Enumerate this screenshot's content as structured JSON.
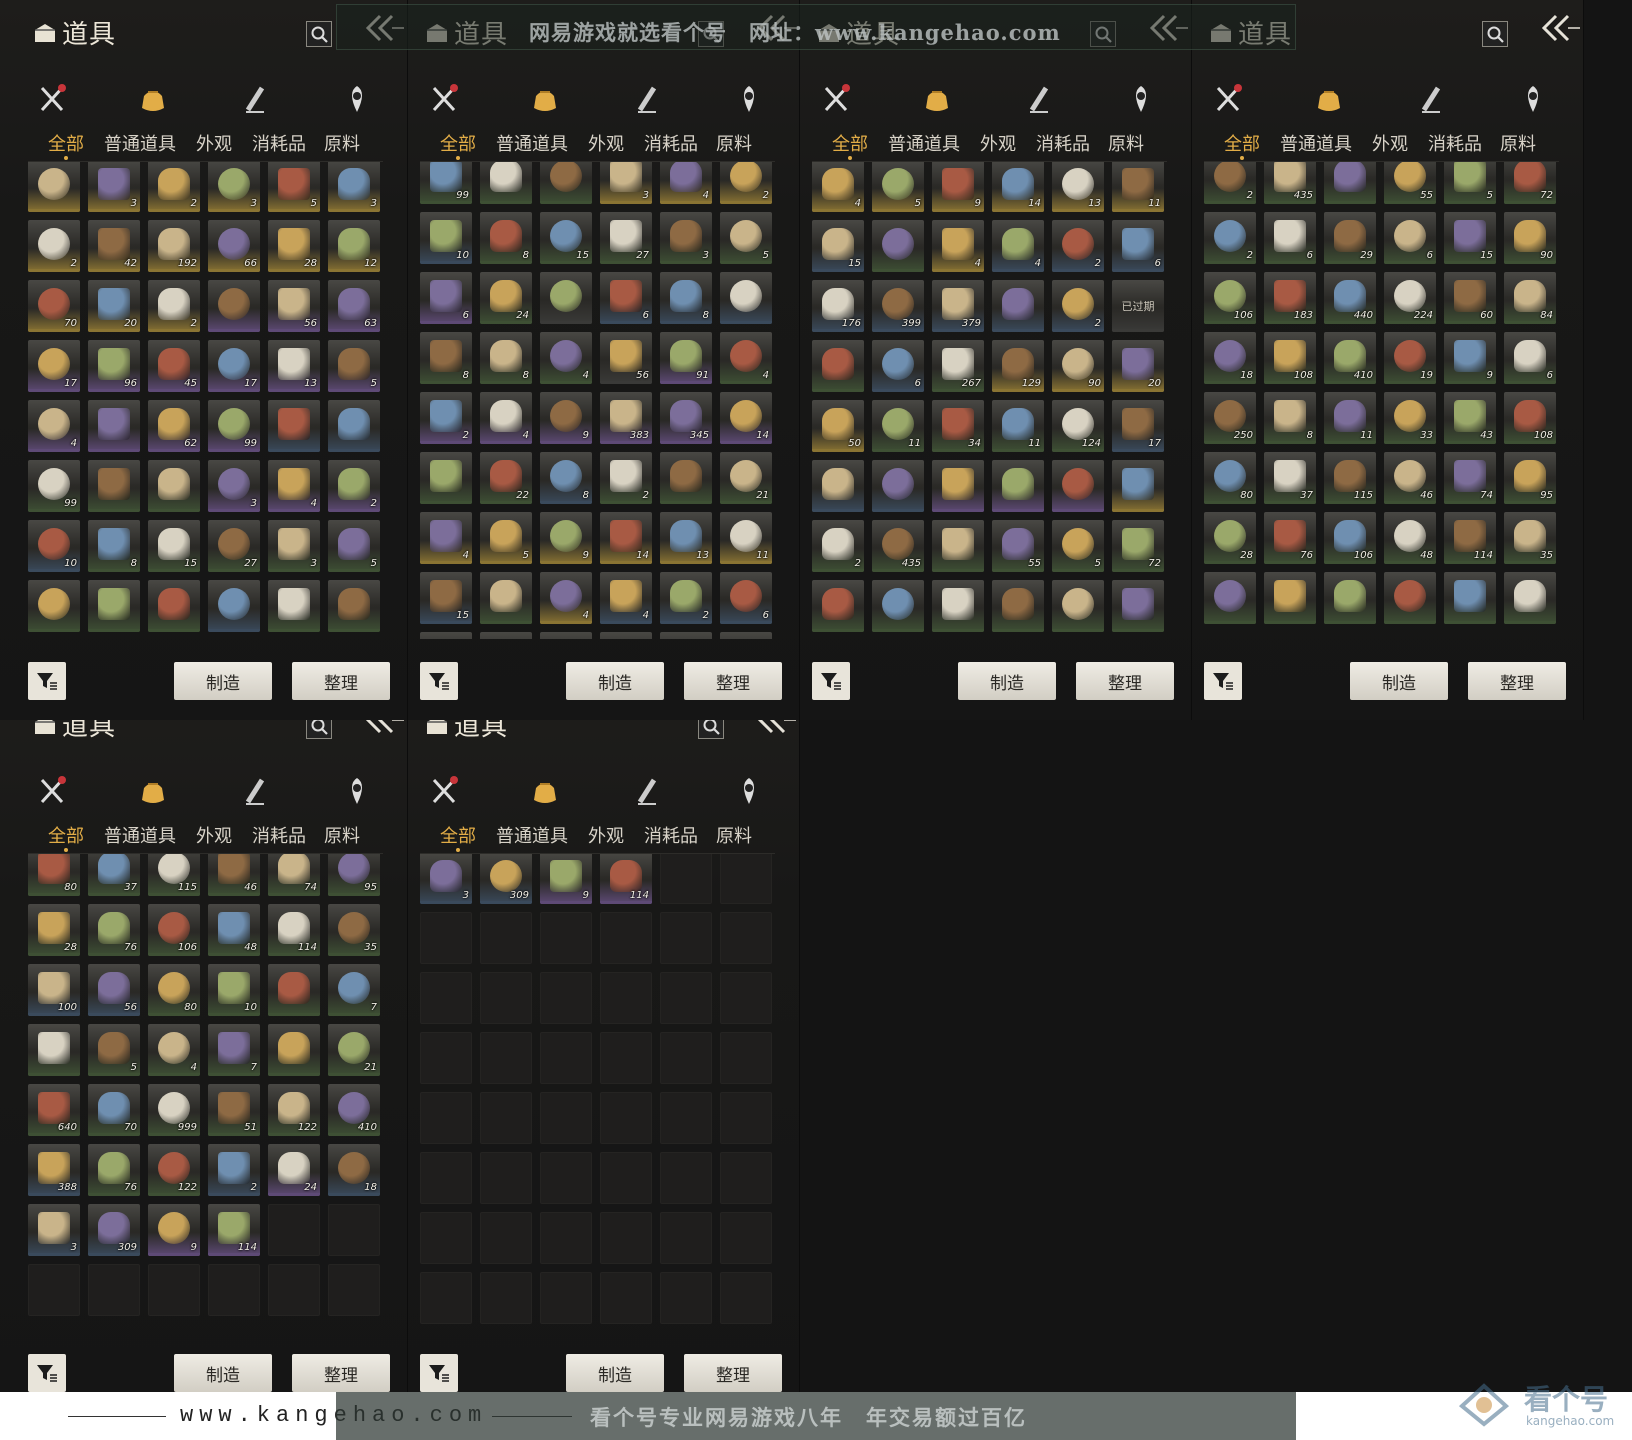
{
  "panel": {
    "title": "道具",
    "tabs": [
      "全部",
      "普通道具",
      "外观",
      "消耗品",
      "原料"
    ],
    "active_tab": "全部",
    "category_icons": [
      "weapons-icon",
      "items-pouch-icon",
      "scroll-icon",
      "quest-icon"
    ],
    "active_category": "items-pouch-icon",
    "make_label": "制造",
    "sort_label": "整理"
  },
  "colors": {
    "gold_tab": "#e2ad47",
    "rarity_gold": "#8a7433",
    "rarity_purple": "#5e4a76",
    "rarity_green": "#3e5034",
    "rarity_blue": "#3a4a5c",
    "rarity_gray": "#3a3a38"
  },
  "panels": [
    {
      "id": "panel-1",
      "slots": [
        [
          "gold",
          ""
        ],
        [
          "gold",
          "3"
        ],
        [
          "gold",
          "2"
        ],
        [
          "gold",
          "3"
        ],
        [
          "gold",
          "5"
        ],
        [
          "gold",
          "3"
        ],
        [
          "gold",
          "2"
        ],
        [
          "gold",
          "42"
        ],
        [
          "gold",
          "192"
        ],
        [
          "gold",
          "66"
        ],
        [
          "gold",
          "28"
        ],
        [
          "gold",
          "12"
        ],
        [
          "gold",
          "70"
        ],
        [
          "gold",
          "20"
        ],
        [
          "gold",
          "2"
        ],
        [
          "purple",
          ""
        ],
        [
          "purple",
          "56"
        ],
        [
          "purple",
          "63"
        ],
        [
          "purple",
          "17"
        ],
        [
          "purple",
          "96"
        ],
        [
          "purple",
          "45"
        ],
        [
          "purple",
          "17"
        ],
        [
          "purple",
          "13"
        ],
        [
          "purple",
          "5"
        ],
        [
          "purple",
          "4"
        ],
        [
          "purple",
          ""
        ],
        [
          "purple",
          "62"
        ],
        [
          "purple",
          "99"
        ],
        [
          "blue",
          ""
        ],
        [
          "blue",
          ""
        ],
        [
          "green",
          "99"
        ],
        [
          "green",
          ""
        ],
        [
          "green",
          ""
        ],
        [
          "purple",
          "3"
        ],
        [
          "purple",
          "4"
        ],
        [
          "purple",
          "2"
        ],
        [
          "blue",
          "10"
        ],
        [
          "green",
          "8"
        ],
        [
          "green",
          "15"
        ],
        [
          "green",
          "27"
        ],
        [
          "green",
          "3"
        ],
        [
          "green",
          "5"
        ],
        [
          "green",
          ""
        ],
        [
          "green",
          ""
        ],
        [
          "green",
          ""
        ],
        [
          "blue",
          ""
        ],
        [
          "green",
          ""
        ],
        [
          "green",
          ""
        ]
      ]
    },
    {
      "id": "panel-2",
      "slots": [
        [
          "green",
          "99"
        ],
        [
          "green",
          ""
        ],
        [
          "green",
          ""
        ],
        [
          "gold",
          "3"
        ],
        [
          "gold",
          "4"
        ],
        [
          "gold",
          "2"
        ],
        [
          "blue",
          "10"
        ],
        [
          "green",
          "8"
        ],
        [
          "green",
          "15"
        ],
        [
          "green",
          "27"
        ],
        [
          "green",
          "3"
        ],
        [
          "green",
          "5"
        ],
        [
          "purple",
          "6"
        ],
        [
          "green",
          "24"
        ],
        [
          "gray",
          ""
        ],
        [
          "blue",
          "6"
        ],
        [
          "blue",
          "8"
        ],
        [
          "blue",
          ""
        ],
        [
          "green",
          "8"
        ],
        [
          "green",
          "8"
        ],
        [
          "green",
          "4"
        ],
        [
          "gray",
          "56"
        ],
        [
          "purple",
          "91"
        ],
        [
          "green",
          "4"
        ],
        [
          "purple",
          "2"
        ],
        [
          "purple",
          "4"
        ],
        [
          "purple",
          "9"
        ],
        [
          "purple",
          "383"
        ],
        [
          "purple",
          "345"
        ],
        [
          "purple",
          "14"
        ],
        [
          "green",
          ""
        ],
        [
          "green",
          "22"
        ],
        [
          "blue",
          "8"
        ],
        [
          "green",
          "2"
        ],
        [
          "green",
          ""
        ],
        [
          "green",
          "21"
        ],
        [
          "gold",
          "4"
        ],
        [
          "gold",
          "5"
        ],
        [
          "gold",
          "9"
        ],
        [
          "gold",
          "14"
        ],
        [
          "gold",
          "13"
        ],
        [
          "gold",
          "11"
        ],
        [
          "blue",
          "15"
        ],
        [
          "green",
          ""
        ],
        [
          "gold",
          "4"
        ],
        [
          "blue",
          "4"
        ],
        [
          "blue",
          "2"
        ],
        [
          "blue",
          "6"
        ],
        [
          "green",
          ""
        ],
        [
          "green",
          ""
        ],
        [
          "green",
          ""
        ],
        [
          "green",
          ""
        ],
        [
          "green",
          ""
        ],
        [
          "green",
          ""
        ]
      ]
    },
    {
      "id": "panel-3",
      "slots": [
        [
          "gold",
          "4"
        ],
        [
          "gold",
          "5"
        ],
        [
          "gold",
          "9"
        ],
        [
          "gold",
          "14"
        ],
        [
          "gold",
          "13"
        ],
        [
          "gold",
          "11"
        ],
        [
          "blue",
          "15"
        ],
        [
          "green",
          ""
        ],
        [
          "gold",
          "4"
        ],
        [
          "blue",
          "4"
        ],
        [
          "blue",
          "2"
        ],
        [
          "blue",
          "6"
        ],
        [
          "blue",
          "176"
        ],
        [
          "blue",
          "399"
        ],
        [
          "blue",
          "379"
        ],
        [
          "blue",
          ""
        ],
        [
          "blue",
          "2"
        ],
        [
          "gray",
          "已过期"
        ],
        [
          "green",
          ""
        ],
        [
          "blue",
          "6"
        ],
        [
          "green",
          "267"
        ],
        [
          "gold",
          "129"
        ],
        [
          "gold",
          "90"
        ],
        [
          "gold",
          "20"
        ],
        [
          "gold",
          "50"
        ],
        [
          "green",
          "11"
        ],
        [
          "green",
          "34"
        ],
        [
          "green",
          "11"
        ],
        [
          "green",
          "124"
        ],
        [
          "blue",
          "17"
        ],
        [
          "blue",
          ""
        ],
        [
          "blue",
          ""
        ],
        [
          "purple",
          ""
        ],
        [
          "purple",
          ""
        ],
        [
          "purple",
          ""
        ],
        [
          "gold",
          ""
        ],
        [
          "green",
          "2"
        ],
        [
          "green",
          "435"
        ],
        [
          "green",
          ""
        ],
        [
          "green",
          "55"
        ],
        [
          "green",
          "5"
        ],
        [
          "green",
          "72"
        ],
        [
          "green",
          ""
        ],
        [
          "green",
          ""
        ],
        [
          "green",
          ""
        ],
        [
          "green",
          ""
        ],
        [
          "green",
          ""
        ],
        [
          "green",
          ""
        ]
      ]
    },
    {
      "id": "panel-4",
      "slots": [
        [
          "green",
          "2"
        ],
        [
          "green",
          "435"
        ],
        [
          "green",
          ""
        ],
        [
          "green",
          "55"
        ],
        [
          "green",
          "5"
        ],
        [
          "green",
          "72"
        ],
        [
          "green",
          "2"
        ],
        [
          "green",
          "6"
        ],
        [
          "green",
          "29"
        ],
        [
          "green",
          "6"
        ],
        [
          "green",
          "15"
        ],
        [
          "green",
          "90"
        ],
        [
          "green",
          "106"
        ],
        [
          "green",
          "183"
        ],
        [
          "green",
          "440"
        ],
        [
          "green",
          "224"
        ],
        [
          "green",
          "60"
        ],
        [
          "green",
          "84"
        ],
        [
          "green",
          "18"
        ],
        [
          "green",
          "108"
        ],
        [
          "green",
          "410"
        ],
        [
          "green",
          "19"
        ],
        [
          "green",
          "9"
        ],
        [
          "green",
          "6"
        ],
        [
          "green",
          "250"
        ],
        [
          "green",
          "8"
        ],
        [
          "green",
          "11"
        ],
        [
          "green",
          "33"
        ],
        [
          "green",
          "43"
        ],
        [
          "green",
          "108"
        ],
        [
          "green",
          "80"
        ],
        [
          "green",
          "37"
        ],
        [
          "green",
          "115"
        ],
        [
          "green",
          "46"
        ],
        [
          "green",
          "74"
        ],
        [
          "green",
          "95"
        ],
        [
          "green",
          "28"
        ],
        [
          "green",
          "76"
        ],
        [
          "green",
          "106"
        ],
        [
          "green",
          "48"
        ],
        [
          "green",
          "114"
        ],
        [
          "green",
          "35"
        ],
        [
          "green",
          ""
        ],
        [
          "green",
          ""
        ],
        [
          "green",
          ""
        ],
        [
          "green",
          ""
        ],
        [
          "green",
          ""
        ],
        [
          "green",
          ""
        ]
      ]
    },
    {
      "id": "panel-5",
      "slots": [
        [
          "green",
          "80"
        ],
        [
          "green",
          "37"
        ],
        [
          "green",
          "115"
        ],
        [
          "green",
          "46"
        ],
        [
          "green",
          "74"
        ],
        [
          "green",
          "95"
        ],
        [
          "green",
          "28"
        ],
        [
          "green",
          "76"
        ],
        [
          "green",
          "106"
        ],
        [
          "green",
          "48"
        ],
        [
          "green",
          "114"
        ],
        [
          "green",
          "35"
        ],
        [
          "blue",
          "100"
        ],
        [
          "blue",
          "56"
        ],
        [
          "green",
          "80"
        ],
        [
          "green",
          "10"
        ],
        [
          "green",
          ""
        ],
        [
          "green",
          "7"
        ],
        [
          "green",
          ""
        ],
        [
          "green",
          "5"
        ],
        [
          "green",
          "4"
        ],
        [
          "green",
          "7"
        ],
        [
          "green",
          ""
        ],
        [
          "green",
          "21"
        ],
        [
          "green",
          "640"
        ],
        [
          "green",
          "70"
        ],
        [
          "green",
          "999"
        ],
        [
          "green",
          "51"
        ],
        [
          "green",
          "122"
        ],
        [
          "green",
          "410"
        ],
        [
          "blue",
          "388"
        ],
        [
          "green",
          "76"
        ],
        [
          "green",
          "122"
        ],
        [
          "blue",
          "2"
        ],
        [
          "purple",
          "24"
        ],
        [
          "blue",
          "18"
        ],
        [
          "blue",
          "3"
        ],
        [
          "blue",
          "309"
        ],
        [
          "purple",
          "9"
        ],
        [
          "purple",
          "114"
        ],
        [
          "empty",
          ""
        ],
        [
          "empty",
          ""
        ],
        [
          "empty",
          ""
        ],
        [
          "empty",
          ""
        ],
        [
          "empty",
          ""
        ],
        [
          "empty",
          ""
        ],
        [
          "empty",
          ""
        ],
        [
          "empty",
          ""
        ]
      ]
    },
    {
      "id": "panel-6",
      "slots": [
        [
          "blue",
          "3"
        ],
        [
          "blue",
          "309"
        ],
        [
          "purple",
          "9"
        ],
        [
          "purple",
          "114"
        ],
        [
          "empty",
          ""
        ],
        [
          "empty",
          ""
        ],
        [
          "empty",
          ""
        ],
        [
          "empty",
          ""
        ],
        [
          "empty",
          ""
        ],
        [
          "empty",
          ""
        ],
        [
          "empty",
          ""
        ],
        [
          "empty",
          ""
        ],
        [
          "empty",
          ""
        ],
        [
          "empty",
          ""
        ],
        [
          "empty",
          ""
        ],
        [
          "empty",
          ""
        ],
        [
          "empty",
          ""
        ],
        [
          "empty",
          ""
        ],
        [
          "empty",
          ""
        ],
        [
          "empty",
          ""
        ],
        [
          "empty",
          ""
        ],
        [
          "empty",
          ""
        ],
        [
          "empty",
          ""
        ],
        [
          "empty",
          ""
        ],
        [
          "empty",
          ""
        ],
        [
          "empty",
          ""
        ],
        [
          "empty",
          ""
        ],
        [
          "empty",
          ""
        ],
        [
          "empty",
          ""
        ],
        [
          "empty",
          ""
        ],
        [
          "empty",
          ""
        ],
        [
          "empty",
          ""
        ],
        [
          "empty",
          ""
        ],
        [
          "empty",
          ""
        ],
        [
          "empty",
          ""
        ],
        [
          "empty",
          ""
        ],
        [
          "empty",
          ""
        ],
        [
          "empty",
          ""
        ],
        [
          "empty",
          ""
        ],
        [
          "empty",
          ""
        ],
        [
          "empty",
          ""
        ],
        [
          "empty",
          ""
        ],
        [
          "empty",
          ""
        ],
        [
          "empty",
          ""
        ],
        [
          "empty",
          ""
        ],
        [
          "empty",
          ""
        ],
        [
          "empty",
          ""
        ],
        [
          "empty",
          ""
        ]
      ]
    }
  ],
  "watermark": {
    "top_text": "网易游戏就选看个号　网址：www.kangehao.com",
    "bottom_url": "www.kangehao.com",
    "bottom_slogan": "看个号专业网易游戏八年　年交易额过百亿",
    "logo_name": "看个号",
    "logo_url": "kangehao.com"
  }
}
